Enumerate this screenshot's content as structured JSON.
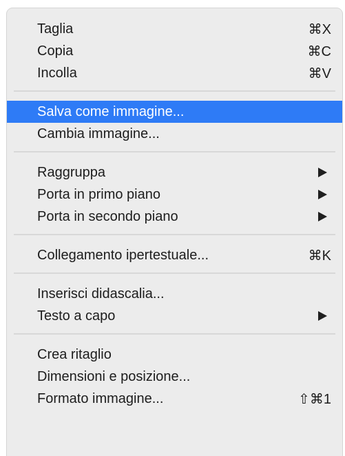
{
  "menu": {
    "items": [
      {
        "label": "Taglia",
        "shortcut": "⌘X"
      },
      {
        "label": "Copia",
        "shortcut": "⌘C"
      },
      {
        "label": "Incolla",
        "shortcut": "⌘V"
      },
      {
        "label": "Salva come immagine...",
        "shortcut": "",
        "highlighted": true
      },
      {
        "label": "Cambia immagine...",
        "shortcut": ""
      },
      {
        "label": "Raggruppa",
        "submenu": true
      },
      {
        "label": "Porta in primo piano",
        "submenu": true
      },
      {
        "label": "Porta in secondo piano",
        "submenu": true
      },
      {
        "label": "Collegamento ipertestuale...",
        "shortcut": "⌘K"
      },
      {
        "label": "Inserisci didascalia...",
        "shortcut": ""
      },
      {
        "label": "Testo a capo",
        "submenu": true
      },
      {
        "label": "Crea ritaglio",
        "shortcut": ""
      },
      {
        "label": "Dimensioni e posizione...",
        "shortcut": ""
      },
      {
        "label": "Formato immagine...",
        "shortcut": "⇧⌘1"
      }
    ],
    "highlight_color": "#2e7bf6",
    "background_color": "#ececec"
  }
}
